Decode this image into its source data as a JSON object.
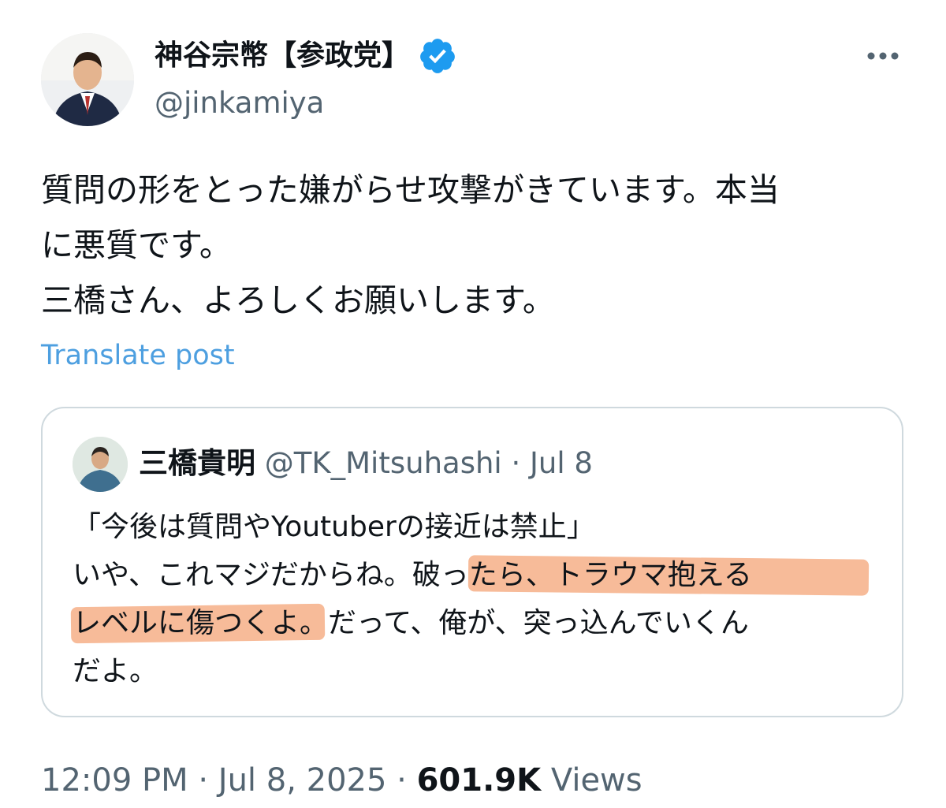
{
  "author": {
    "name": "神谷宗幣【参政党】",
    "handle": "@jinkamiya",
    "verified": true
  },
  "post": {
    "lines": [
      "質問の形をとった嫌がらせ攻撃がきています。本当",
      "に悪質です。",
      "三橋さん、よろしくお願いします。"
    ],
    "translate_label": "Translate post"
  },
  "quote": {
    "name": "三橋貴明",
    "handle": "@TK_Mitsuhashi",
    "separator": " · ",
    "date": "Jul 8",
    "lines": [
      "「今後は質問やYoutuberの接近は禁止」",
      "いや、これマジだからね。破ったら、トラウマ抱える",
      "レベルに傷つくよ。だって、俺が、突っ込んでいくん",
      "だよ。"
    ]
  },
  "footer": {
    "time": "12:09 PM",
    "separator": " · ",
    "date": "Jul 8, 2025",
    "views_count": "601.9K",
    "views_label": "Views"
  },
  "colors": {
    "link": "#4d9fe0",
    "verified_badge": "#1d9bf0",
    "highlight": "#f4a477",
    "muted": "#536471"
  },
  "icons": {
    "verified": "verified-badge-icon",
    "more": "more-dots-icon"
  }
}
